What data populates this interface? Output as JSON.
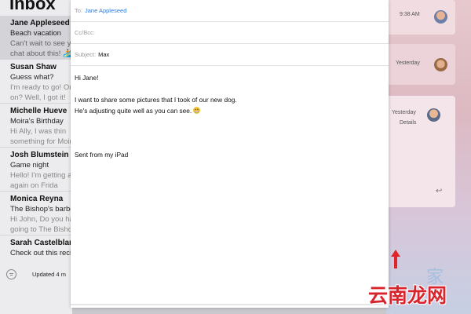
{
  "mail_list": {
    "title": "Inbox",
    "items": [
      {
        "sender": "Jane Appleseed",
        "subject": "Beach vacation",
        "preview1": "Can't wait to see yo",
        "preview2": "chat about this!"
      },
      {
        "sender": "Susan Shaw",
        "subject": "Guess what?",
        "preview1": "I'm ready to go! On",
        "preview2": "on? Well, I got it!"
      },
      {
        "sender": "Michelle Hueve",
        "subject": "Moira's Birthday",
        "preview1": "Hi Ally, I was thin",
        "preview2": "something for Moira"
      },
      {
        "sender": "Josh Blumstein",
        "subject": "Game night",
        "preview1": "Hello! I'm getting a",
        "preview2": "again on Frida"
      },
      {
        "sender": "Monica Reyna",
        "subject": "The Bishop's barbe",
        "preview1": "Hi John, Do you hav",
        "preview2": "going to The Bishop"
      },
      {
        "sender": "Sarah Castelblan",
        "subject": "Check out this recip",
        "preview1": "",
        "preview2": ""
      }
    ],
    "status": "Updated 4 m"
  },
  "compose": {
    "to_label": "To:",
    "to_value": "Jane Appleseed",
    "cc_label": "Cc/Bcc:",
    "subject_label": "Subject:",
    "subject_value": "Max",
    "greeting": "Hi Jane!",
    "line1": "I want to share some pictures that I took of our new dog.",
    "line2": "He's adjusting quite well as you can see.",
    "signature": "Sent from my iPad"
  },
  "thread": {
    "cards": [
      {
        "time": "9:38 AM"
      },
      {
        "time": "Yesterday"
      },
      {
        "time": "Yesterday",
        "sub": "Details"
      }
    ]
  },
  "watermark": {
    "text": "云南龙网",
    "glyph": "家"
  },
  "colors": {
    "link": "#2e7bd6",
    "arrow": "#e0242c"
  }
}
